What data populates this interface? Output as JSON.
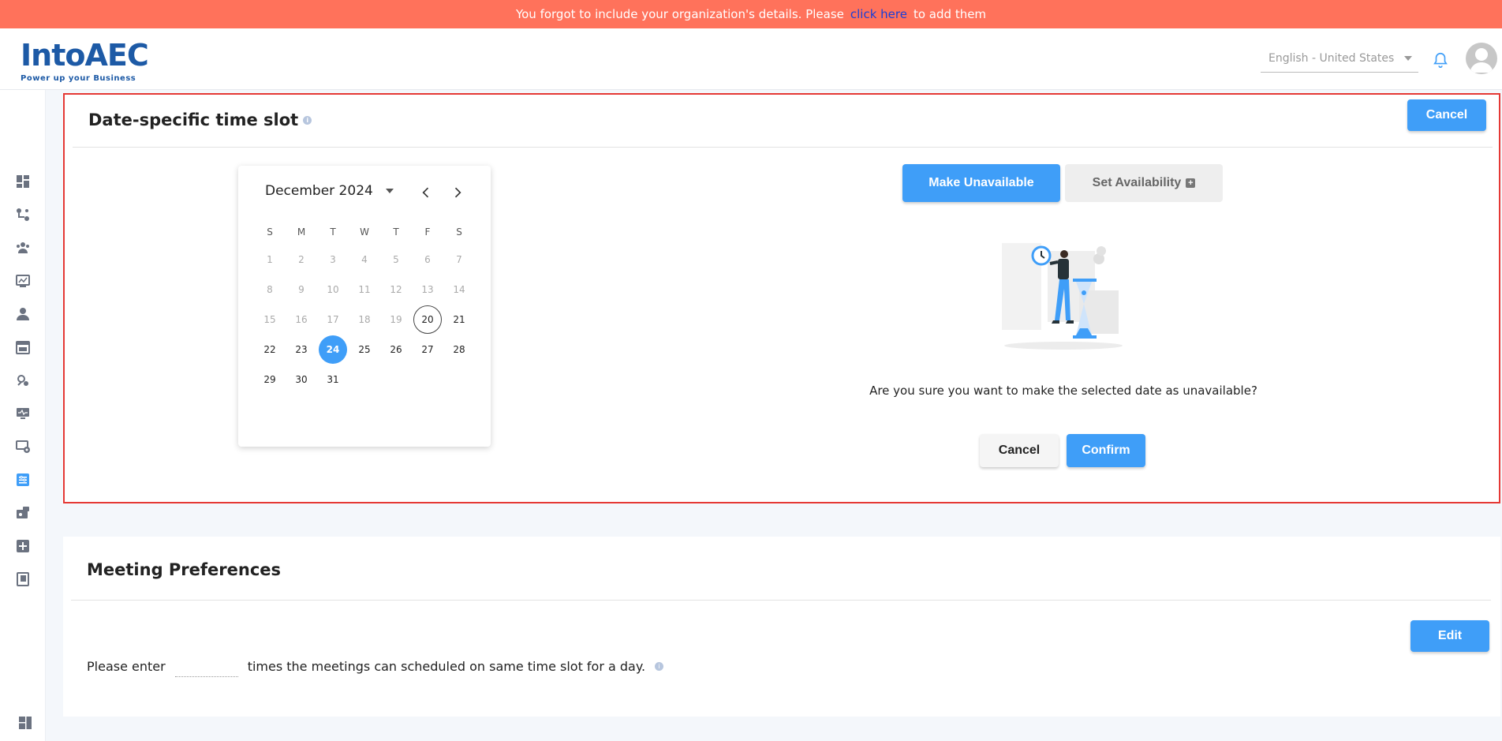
{
  "banner": {
    "text_before": "You forgot to include your organization's details. Please",
    "link": "click here",
    "text_after": "to add them"
  },
  "header": {
    "logo_main": "IntoAEC",
    "logo_tagline": "Power up your Business",
    "language": "English - United States"
  },
  "sidebar": {
    "icons": [
      "dashboard-icon",
      "workflow-icon",
      "team-icon",
      "report-icon",
      "user-icon",
      "calendar-icon",
      "tools-icon",
      "monitor-icon",
      "settings-icon",
      "schedule-icon",
      "video-icon",
      "add-icon",
      "book-icon",
      "layout-icon"
    ]
  },
  "slot_panel": {
    "title": "Date-specific time slot",
    "cancel_label": "Cancel",
    "make_unavailable_label": "Make Unavailable",
    "set_availability_label": "Set Availability",
    "question": "Are you sure you want to make the selected date as unavailable?",
    "dialog_cancel_label": "Cancel",
    "dialog_confirm_label": "Confirm"
  },
  "calendar": {
    "month_label": "December 2024",
    "weekdays": [
      "S",
      "M",
      "T",
      "W",
      "T",
      "F",
      "S"
    ],
    "days": [
      {
        "d": "1",
        "s": "disabled"
      },
      {
        "d": "2",
        "s": "disabled"
      },
      {
        "d": "3",
        "s": "disabled"
      },
      {
        "d": "4",
        "s": "disabled"
      },
      {
        "d": "5",
        "s": "disabled"
      },
      {
        "d": "6",
        "s": "disabled"
      },
      {
        "d": "7",
        "s": "disabled"
      },
      {
        "d": "8",
        "s": "disabled"
      },
      {
        "d": "9",
        "s": "disabled"
      },
      {
        "d": "10",
        "s": "disabled"
      },
      {
        "d": "11",
        "s": "disabled"
      },
      {
        "d": "12",
        "s": "disabled"
      },
      {
        "d": "13",
        "s": "disabled"
      },
      {
        "d": "14",
        "s": "disabled"
      },
      {
        "d": "15",
        "s": "disabled"
      },
      {
        "d": "16",
        "s": "disabled"
      },
      {
        "d": "17",
        "s": "disabled"
      },
      {
        "d": "18",
        "s": "disabled"
      },
      {
        "d": "19",
        "s": "disabled"
      },
      {
        "d": "20",
        "s": "today"
      },
      {
        "d": "21",
        "s": ""
      },
      {
        "d": "22",
        "s": ""
      },
      {
        "d": "23",
        "s": ""
      },
      {
        "d": "24",
        "s": "selected"
      },
      {
        "d": "25",
        "s": ""
      },
      {
        "d": "26",
        "s": ""
      },
      {
        "d": "27",
        "s": ""
      },
      {
        "d": "28",
        "s": ""
      },
      {
        "d": "29",
        "s": ""
      },
      {
        "d": "30",
        "s": ""
      },
      {
        "d": "31",
        "s": ""
      }
    ]
  },
  "preferences": {
    "title": "Meeting Preferences",
    "edit_label": "Edit",
    "text_before": "Please enter",
    "text_after": "times the meetings can scheduled on same time slot for a day.",
    "input_value": ""
  },
  "colors": {
    "accent": "#3f9ef8",
    "banner": "#ff725b",
    "link": "#1a3fd8",
    "highlight_border": "#e53935"
  }
}
